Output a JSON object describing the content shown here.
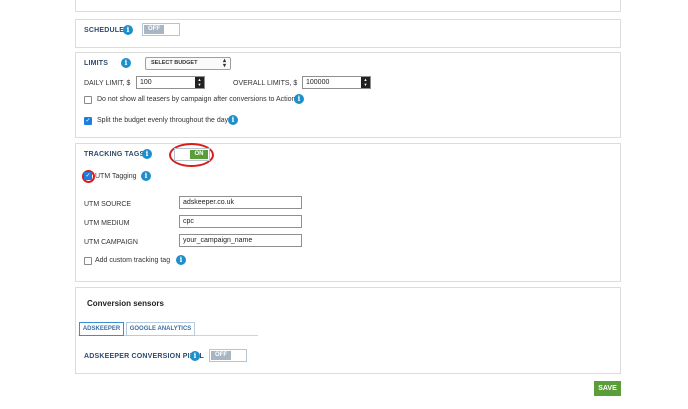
{
  "schedule": {
    "title": "SCHEDULE",
    "toggle_label": "OFF"
  },
  "limits": {
    "title": "LIMITS",
    "select_placeholder": "SELECT BUDGET",
    "daily_label": "DAILY LIMIT, $",
    "daily_value": "100",
    "overall_label": "OVERALL LIMITS, $",
    "overall_value": "100000",
    "checkbox1_label": "Do not show all teasers by campaign after conversions to Action",
    "checkbox1_checked": false,
    "checkbox2_label": "Split the budget evenly throughout the day",
    "checkbox2_checked": true
  },
  "tracking": {
    "title": "TRACKING TAGS",
    "toggle_label": "ON",
    "utm_tagging_label": "UTM Tagging",
    "utm_tagging_checked": true,
    "utm_source_label": "UTM SOURCE",
    "utm_source_value": "adskeeper.co.uk",
    "utm_medium_label": "UTM MEDIUM",
    "utm_medium_value": "cpc",
    "utm_campaign_label": "UTM CAMPAIGN",
    "utm_campaign_value": "your_campaign_name",
    "custom_tag_label": "Add custom tracking tag",
    "custom_tag_checked": false
  },
  "conversion": {
    "title": "Conversion sensors",
    "tabs": [
      {
        "label": "ADSKEEPER",
        "active": true
      },
      {
        "label": "GOOGLE ANALYTICS",
        "active": false
      }
    ],
    "pixel_label": "ADSKEEPER CONVERSION PIXEL",
    "pixel_toggle_label": "OFF"
  },
  "footer": {
    "save_label": "SAVE"
  },
  "icons": {
    "info": "info-icon",
    "check": "checkmark-icon",
    "select_arrow": "up-down-arrow-icon",
    "stepper": "stepper-arrows-icon"
  },
  "colors": {
    "accent_green": "#5a9e3a",
    "info_blue": "#1e8fcb",
    "title_navy": "#2d4a6e",
    "highlight_red": "#d71e1e",
    "tab_blue": "#3a6ea5"
  }
}
